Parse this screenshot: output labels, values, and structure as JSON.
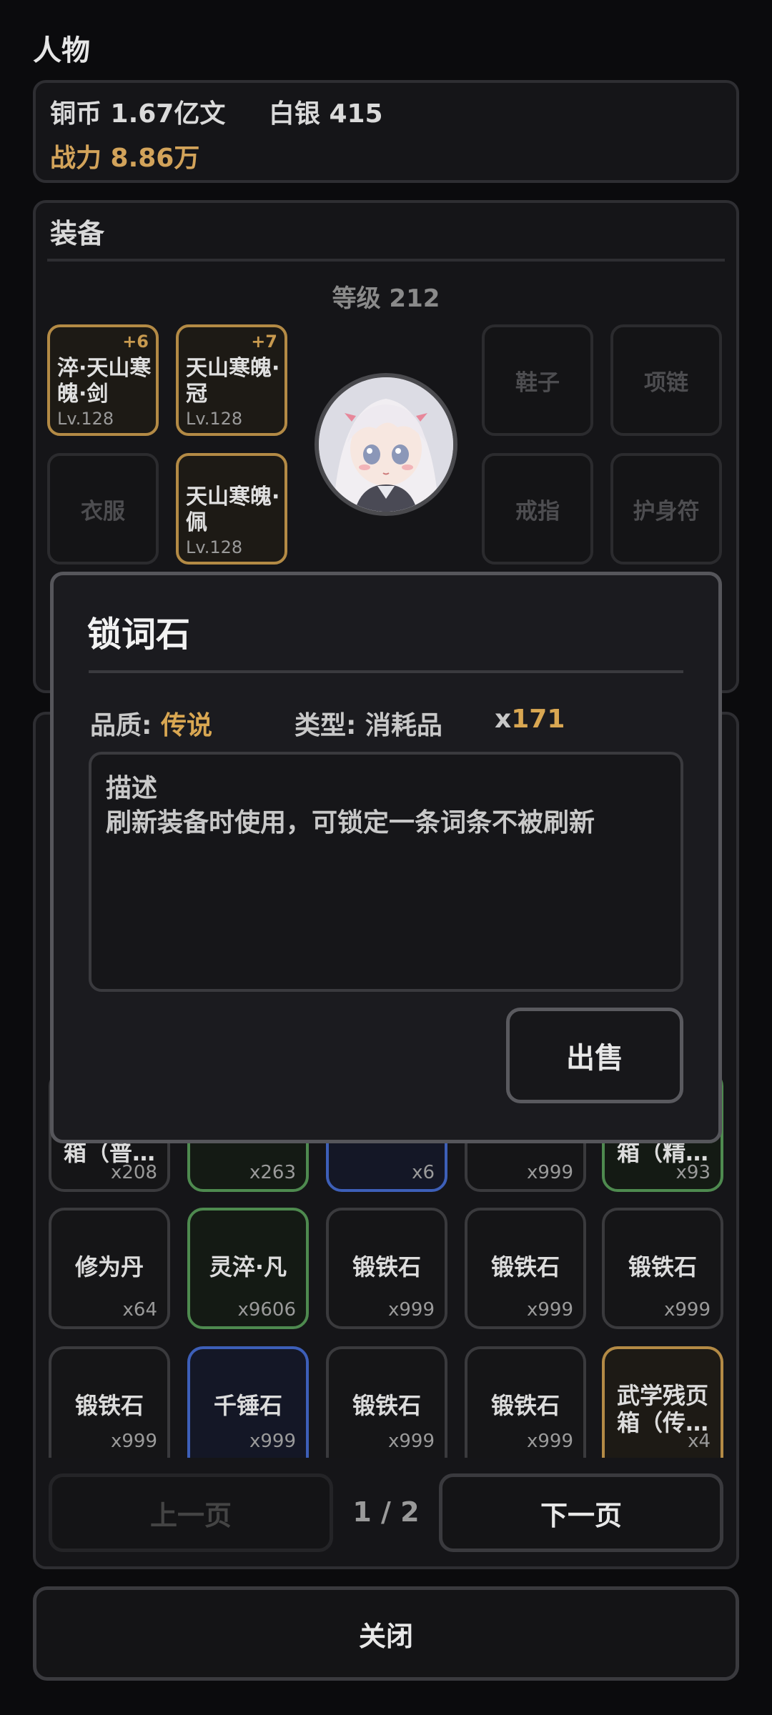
{
  "header": {
    "title": "人物"
  },
  "currency": {
    "copper": "铜币 1.67亿文",
    "silver": "白银 415",
    "power": "战力 8.86万"
  },
  "equipment": {
    "title": "装备",
    "level": "等级 212",
    "slots": [
      {
        "name": "淬·天山寒魄·剑",
        "plus": "+6",
        "level": "Lv.128"
      },
      {
        "name": "天山寒魄·冠",
        "plus": "+7",
        "level": "Lv.128"
      },
      {
        "label": "鞋子"
      },
      {
        "label": "项链"
      },
      {
        "label": "衣服"
      },
      {
        "name": "天山寒魄·佩",
        "level": "Lv.128"
      },
      {
        "label": "戒指"
      },
      {
        "label": "护身符"
      }
    ]
  },
  "inventory": {
    "partial_row": [
      {
        "name": "箱（普…",
        "qty": "x208",
        "rarity": "common"
      },
      {
        "name": "",
        "qty": "x263",
        "rarity": "green"
      },
      {
        "name": "",
        "qty": "x6",
        "rarity": "blue"
      },
      {
        "name": "",
        "qty": "x999",
        "rarity": "common"
      },
      {
        "name": "箱（精…",
        "qty": "x93",
        "rarity": "green"
      }
    ],
    "row2": [
      {
        "name": "修为丹",
        "qty": "x64",
        "rarity": "common"
      },
      {
        "name": "灵淬·凡",
        "qty": "x9606",
        "rarity": "green"
      },
      {
        "name": "锻铁石",
        "qty": "x999",
        "rarity": "common"
      },
      {
        "name": "锻铁石",
        "qty": "x999",
        "rarity": "common"
      },
      {
        "name": "锻铁石",
        "qty": "x999",
        "rarity": "common"
      }
    ],
    "row3": [
      {
        "name": "锻铁石",
        "qty": "x999",
        "rarity": "common"
      },
      {
        "name": "千锤石",
        "qty": "x999",
        "rarity": "blue"
      },
      {
        "name": "锻铁石",
        "qty": "x999",
        "rarity": "common"
      },
      {
        "name": "锻铁石",
        "qty": "x999",
        "rarity": "common"
      },
      {
        "name": "武学残页箱（传…",
        "qty": "x4",
        "rarity": "gold"
      }
    ]
  },
  "pagination": {
    "prev": "上一页",
    "page": "1 / 2",
    "next": "下一页"
  },
  "close_label": "关闭",
  "modal": {
    "title": "锁词石",
    "quality_label": "品质:",
    "quality_value": "传说",
    "type": "类型: 消耗品",
    "count_prefix": "x",
    "count_value": "171",
    "desc_label": "描述",
    "desc_text": "刷新装备时使用，可锁定一条词条不被刷新",
    "sell_label": "出售"
  },
  "colors": {
    "gold": "#d9a752",
    "green": "#4e8a4f",
    "blue": "#3d5fb8",
    "background": "#0b0b0d"
  }
}
